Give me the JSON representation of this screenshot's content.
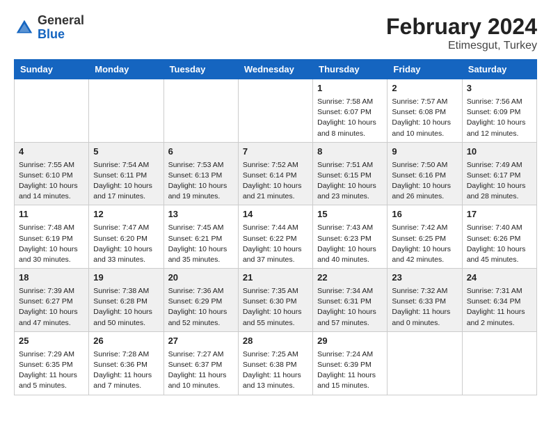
{
  "header": {
    "logo_general": "General",
    "logo_blue": "Blue",
    "month_year": "February 2024",
    "location": "Etimesgut, Turkey"
  },
  "days_of_week": [
    "Sunday",
    "Monday",
    "Tuesday",
    "Wednesday",
    "Thursday",
    "Friday",
    "Saturday"
  ],
  "weeks": [
    [
      {
        "day": "",
        "info": ""
      },
      {
        "day": "",
        "info": ""
      },
      {
        "day": "",
        "info": ""
      },
      {
        "day": "",
        "info": ""
      },
      {
        "day": "1",
        "info": "Sunrise: 7:58 AM\nSunset: 6:07 PM\nDaylight: 10 hours\nand 8 minutes."
      },
      {
        "day": "2",
        "info": "Sunrise: 7:57 AM\nSunset: 6:08 PM\nDaylight: 10 hours\nand 10 minutes."
      },
      {
        "day": "3",
        "info": "Sunrise: 7:56 AM\nSunset: 6:09 PM\nDaylight: 10 hours\nand 12 minutes."
      }
    ],
    [
      {
        "day": "4",
        "info": "Sunrise: 7:55 AM\nSunset: 6:10 PM\nDaylight: 10 hours\nand 14 minutes."
      },
      {
        "day": "5",
        "info": "Sunrise: 7:54 AM\nSunset: 6:11 PM\nDaylight: 10 hours\nand 17 minutes."
      },
      {
        "day": "6",
        "info": "Sunrise: 7:53 AM\nSunset: 6:13 PM\nDaylight: 10 hours\nand 19 minutes."
      },
      {
        "day": "7",
        "info": "Sunrise: 7:52 AM\nSunset: 6:14 PM\nDaylight: 10 hours\nand 21 minutes."
      },
      {
        "day": "8",
        "info": "Sunrise: 7:51 AM\nSunset: 6:15 PM\nDaylight: 10 hours\nand 23 minutes."
      },
      {
        "day": "9",
        "info": "Sunrise: 7:50 AM\nSunset: 6:16 PM\nDaylight: 10 hours\nand 26 minutes."
      },
      {
        "day": "10",
        "info": "Sunrise: 7:49 AM\nSunset: 6:17 PM\nDaylight: 10 hours\nand 28 minutes."
      }
    ],
    [
      {
        "day": "11",
        "info": "Sunrise: 7:48 AM\nSunset: 6:19 PM\nDaylight: 10 hours\nand 30 minutes."
      },
      {
        "day": "12",
        "info": "Sunrise: 7:47 AM\nSunset: 6:20 PM\nDaylight: 10 hours\nand 33 minutes."
      },
      {
        "day": "13",
        "info": "Sunrise: 7:45 AM\nSunset: 6:21 PM\nDaylight: 10 hours\nand 35 minutes."
      },
      {
        "day": "14",
        "info": "Sunrise: 7:44 AM\nSunset: 6:22 PM\nDaylight: 10 hours\nand 37 minutes."
      },
      {
        "day": "15",
        "info": "Sunrise: 7:43 AM\nSunset: 6:23 PM\nDaylight: 10 hours\nand 40 minutes."
      },
      {
        "day": "16",
        "info": "Sunrise: 7:42 AM\nSunset: 6:25 PM\nDaylight: 10 hours\nand 42 minutes."
      },
      {
        "day": "17",
        "info": "Sunrise: 7:40 AM\nSunset: 6:26 PM\nDaylight: 10 hours\nand 45 minutes."
      }
    ],
    [
      {
        "day": "18",
        "info": "Sunrise: 7:39 AM\nSunset: 6:27 PM\nDaylight: 10 hours\nand 47 minutes."
      },
      {
        "day": "19",
        "info": "Sunrise: 7:38 AM\nSunset: 6:28 PM\nDaylight: 10 hours\nand 50 minutes."
      },
      {
        "day": "20",
        "info": "Sunrise: 7:36 AM\nSunset: 6:29 PM\nDaylight: 10 hours\nand 52 minutes."
      },
      {
        "day": "21",
        "info": "Sunrise: 7:35 AM\nSunset: 6:30 PM\nDaylight: 10 hours\nand 55 minutes."
      },
      {
        "day": "22",
        "info": "Sunrise: 7:34 AM\nSunset: 6:31 PM\nDaylight: 10 hours\nand 57 minutes."
      },
      {
        "day": "23",
        "info": "Sunrise: 7:32 AM\nSunset: 6:33 PM\nDaylight: 11 hours\nand 0 minutes."
      },
      {
        "day": "24",
        "info": "Sunrise: 7:31 AM\nSunset: 6:34 PM\nDaylight: 11 hours\nand 2 minutes."
      }
    ],
    [
      {
        "day": "25",
        "info": "Sunrise: 7:29 AM\nSunset: 6:35 PM\nDaylight: 11 hours\nand 5 minutes."
      },
      {
        "day": "26",
        "info": "Sunrise: 7:28 AM\nSunset: 6:36 PM\nDaylight: 11 hours\nand 7 minutes."
      },
      {
        "day": "27",
        "info": "Sunrise: 7:27 AM\nSunset: 6:37 PM\nDaylight: 11 hours\nand 10 minutes."
      },
      {
        "day": "28",
        "info": "Sunrise: 7:25 AM\nSunset: 6:38 PM\nDaylight: 11 hours\nand 13 minutes."
      },
      {
        "day": "29",
        "info": "Sunrise: 7:24 AM\nSunset: 6:39 PM\nDaylight: 11 hours\nand 15 minutes."
      },
      {
        "day": "",
        "info": ""
      },
      {
        "day": "",
        "info": ""
      }
    ]
  ]
}
